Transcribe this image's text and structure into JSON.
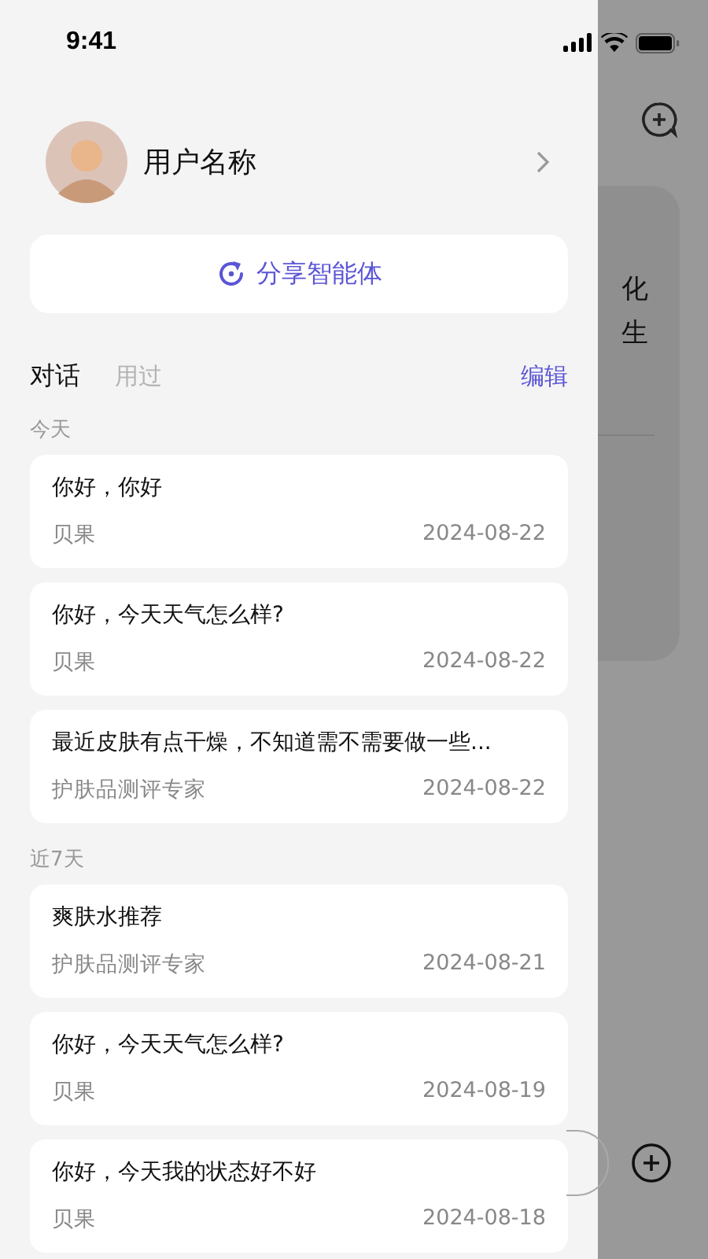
{
  "status_bar": {
    "time": "9:41"
  },
  "profile": {
    "name": "用户名称"
  },
  "share_button": {
    "label": "分享智能体"
  },
  "tabs": [
    {
      "label": "对话",
      "selected": true
    },
    {
      "label": "用过",
      "selected": false
    }
  ],
  "edit_link": "编辑",
  "sections": [
    {
      "title": "今天",
      "items": [
        {
          "title": "你好，你好",
          "agent": "贝果",
          "date": "2024-08-22"
        },
        {
          "title": "你好，今天天气怎么样?",
          "agent": "贝果",
          "date": "2024-08-22"
        },
        {
          "title": "最近皮肤有点干燥，不知道需不需要做一些...",
          "agent": "护肤品测评专家",
          "date": "2024-08-22"
        }
      ]
    },
    {
      "title": "近7天",
      "items": [
        {
          "title": "爽肤水推荐",
          "agent": "护肤品测评专家",
          "date": "2024-08-21"
        },
        {
          "title": "你好，今天天气怎么样?",
          "agent": "贝果",
          "date": "2024-08-19"
        },
        {
          "title": "你好，今天我的状态好不好",
          "agent": "贝果",
          "date": "2024-08-18"
        }
      ]
    }
  ],
  "background": {
    "lines": [
      "化",
      "生"
    ]
  }
}
